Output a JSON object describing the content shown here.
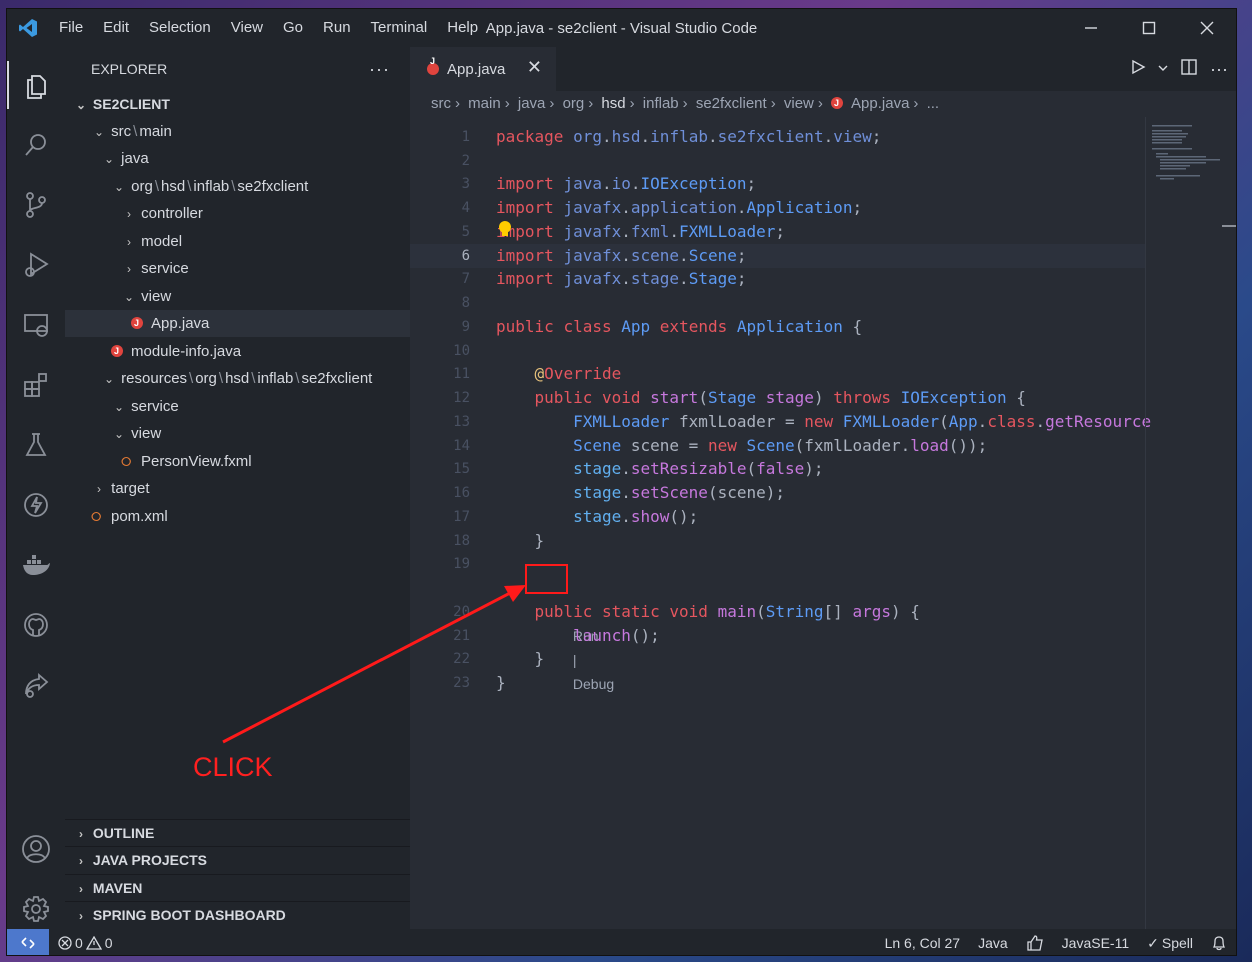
{
  "window": {
    "title": "App.java - se2client - Visual Studio Code",
    "menu": [
      "File",
      "Edit",
      "Selection",
      "View",
      "Go",
      "Run",
      "Terminal",
      "Help"
    ]
  },
  "activity_bar": [
    "explorer-icon",
    "search-icon",
    "source-control-icon",
    "run-debug-icon",
    "remote-explorer-icon",
    "extensions-icon",
    "testing-icon",
    "thunder-icon",
    "docker-icon",
    "github-icon",
    "live-share-icon",
    "account-icon",
    "settings-gear-icon"
  ],
  "sidebar": {
    "header": "EXPLORER",
    "more": "···",
    "tree": [
      {
        "label": "SE2CLIENT",
        "chevron": "v",
        "indent": 0,
        "bold": true
      },
      {
        "label": "src",
        "label2": "main",
        "chevron": "v",
        "indent": 1
      },
      {
        "label": "java",
        "chevron": "v",
        "indent": 2
      },
      {
        "label": "org",
        "label2": "hsd",
        "label3": "inflab",
        "label4": "se2fxclient",
        "chevron": "v",
        "indent": 3
      },
      {
        "label": "controller",
        "chevron": ">",
        "indent": 4
      },
      {
        "label": "model",
        "chevron": ">",
        "indent": 4
      },
      {
        "label": "service",
        "chevron": ">",
        "indent": 4
      },
      {
        "label": "view",
        "chevron": "v",
        "indent": 4
      },
      {
        "label": "App.java",
        "icon": "java",
        "indent": 5,
        "selected": true
      },
      {
        "label": "module-info.java",
        "icon": "java",
        "indent": 3
      },
      {
        "label": "resources",
        "label2": "org",
        "label3": "hsd",
        "label4": "inflab",
        "label5": "se2fxclient",
        "chevron": "v",
        "indent": 2
      },
      {
        "label": "service",
        "chevron": "v",
        "indent": 3
      },
      {
        "label": "view",
        "chevron": "v",
        "indent": 3
      },
      {
        "label": "PersonView.fxml",
        "icon": "xml",
        "indent": 4
      },
      {
        "label": "target",
        "chevron": ">",
        "indent": 1
      },
      {
        "label": "pom.xml",
        "icon": "xml",
        "indent": 1
      }
    ],
    "sections": [
      "OUTLINE",
      "JAVA PROJECTS",
      "MAVEN",
      "SPRING BOOT DASHBOARD"
    ]
  },
  "editor": {
    "tab_label": "App.java",
    "tab_close": "✕",
    "breadcrumb": [
      "src",
      "main",
      "java",
      "org",
      "hsd",
      "inflab",
      "se2fxclient",
      "view",
      "App.java",
      "..."
    ],
    "codelens": {
      "run": "Run",
      "sep": "|",
      "debug": "Debug"
    },
    "lines": [
      "1",
      "2",
      "3",
      "4",
      "5",
      "6",
      "7",
      "8",
      "9",
      "10",
      "11",
      "12",
      "13",
      "14",
      "15",
      "16",
      "17",
      "18",
      "19",
      "20",
      "21",
      "22",
      "23"
    ]
  },
  "annotation": {
    "label": "CLICK"
  },
  "statusbar": {
    "errors": "0",
    "warnings": "0",
    "position": "Ln 6, Col 27",
    "language": "Java",
    "java_version": "JavaSE-11",
    "spell": "Spell"
  }
}
